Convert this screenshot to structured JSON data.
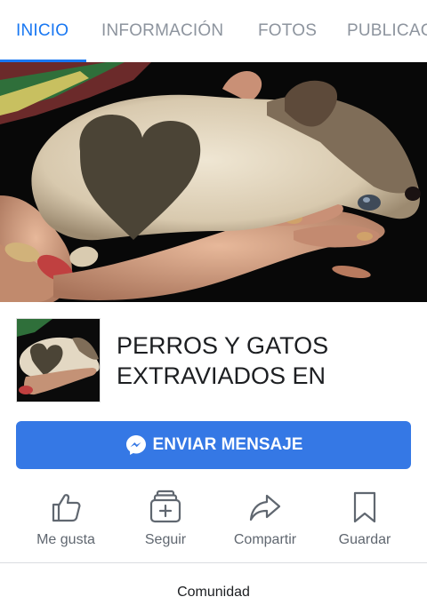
{
  "tabs": [
    {
      "label": "INICIO",
      "active": true
    },
    {
      "label": "INFORMACIÓN",
      "active": false
    },
    {
      "label": "FOTOS",
      "active": false
    },
    {
      "label": "PUBLICACIONES",
      "active": false
    }
  ],
  "page": {
    "name": "PERROS Y GATOS EXTRAVIADOS EN"
  },
  "message_button": {
    "label": "ENVIAR MENSAJE",
    "icon": "messenger-icon",
    "color": "#3578e5"
  },
  "actions": [
    {
      "label": "Me gusta",
      "icon": "thumbs-up-icon"
    },
    {
      "label": "Seguir",
      "icon": "follow-icon"
    },
    {
      "label": "Compartir",
      "icon": "share-icon"
    },
    {
      "label": "Guardar",
      "icon": "bookmark-icon"
    }
  ],
  "section": {
    "label": "Comunidad"
  },
  "colors": {
    "accent": "#1877f2",
    "inactive_tab": "#8d949e",
    "action_text": "#606770"
  }
}
